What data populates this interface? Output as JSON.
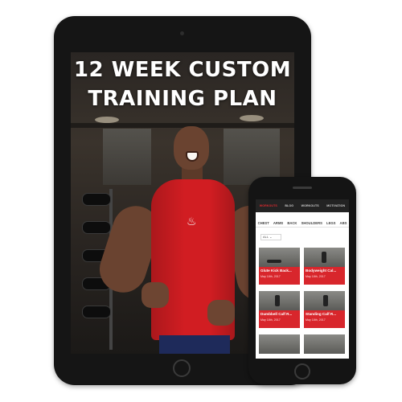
{
  "tablet": {
    "title_line1": "12 WEEK CUSTOM",
    "title_line2": "TRAINING PLAN"
  },
  "phone": {
    "nav": [
      "WORKOUTS",
      "BLOG",
      "WORKOUTS",
      "MOTIVATION"
    ],
    "categories": [
      "CHEST",
      "ARMS",
      "BACK",
      "SHOULDERS",
      "LEGS",
      "ABS"
    ],
    "filter": "ALL",
    "cards": [
      {
        "title": "Glute Kick Back...",
        "date": "May 18th, 2017"
      },
      {
        "title": "Bodyweight Cal...",
        "date": "May 18th, 2017"
      },
      {
        "title": "Dumbbell Calf R...",
        "date": "May 18th, 2017"
      },
      {
        "title": "Standing Calf R...",
        "date": "May 18th, 2017"
      }
    ]
  },
  "colors": {
    "accent_red": "#d8262c",
    "device_black": "#151515",
    "nav_dark": "#232323"
  }
}
